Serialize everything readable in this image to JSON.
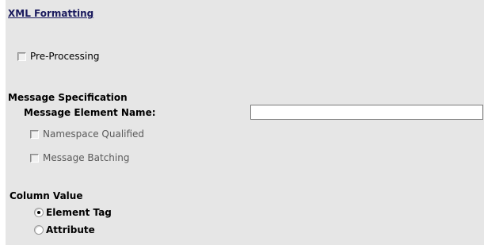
{
  "xml_formatting": {
    "title": "XML Formatting",
    "pre_processing": {
      "label": "Pre-Processing",
      "checked": false,
      "enabled": true
    }
  },
  "message_specification": {
    "title": "Message Specification",
    "element_name_label": "Message Element Name:",
    "element_name_value": "",
    "namespace_qualified": {
      "label": "Namespace Qualified",
      "checked": false,
      "enabled": false
    },
    "message_batching": {
      "label": "Message Batching",
      "checked": false,
      "enabled": false
    }
  },
  "column_value": {
    "title": "Column Value",
    "options": [
      {
        "label": "Element Tag",
        "selected": true
      },
      {
        "label": "Attribute",
        "selected": false
      }
    ]
  }
}
